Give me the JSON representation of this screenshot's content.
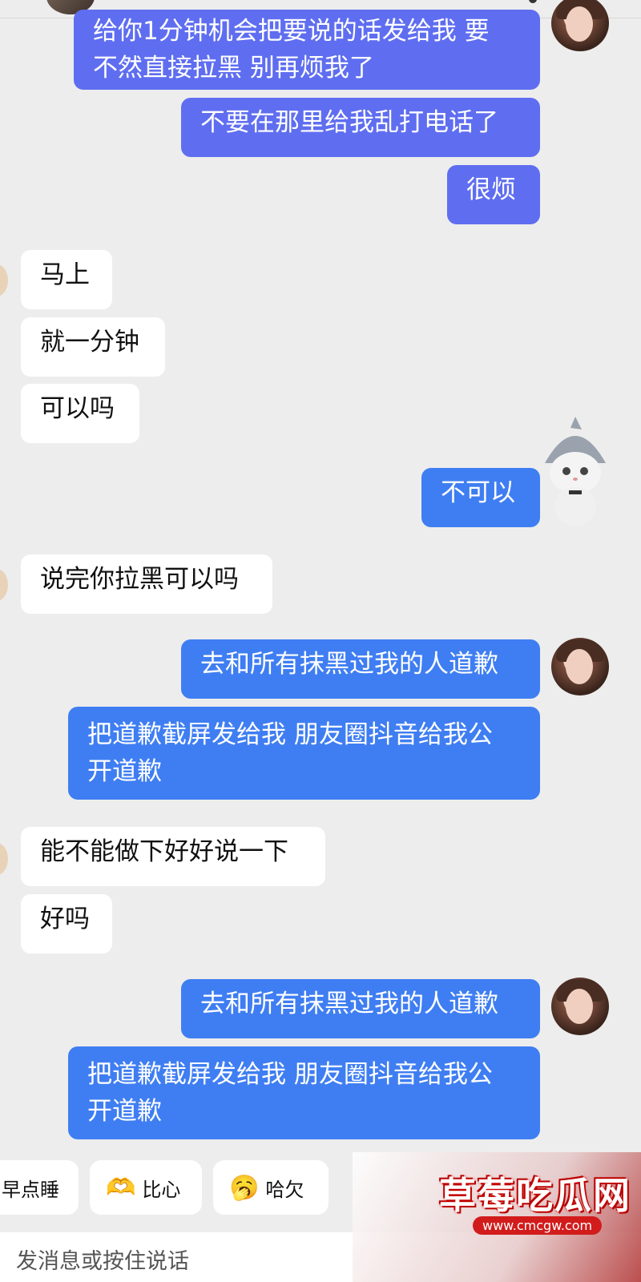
{
  "messages": [
    {
      "text": "给你1分钟机会把要说的话发给我 要\n不然直接拉黑 别再烦我了"
    },
    {
      "text": "不要在那里给我乱打电话了"
    },
    {
      "text": "很烦"
    },
    {
      "text": "马上"
    },
    {
      "text": "就一分钟"
    },
    {
      "text": "可以吗"
    },
    {
      "text": "不可以"
    },
    {
      "text": "说完你拉黑可以吗"
    },
    {
      "text": "去和所有抹黑过我的人道歉"
    },
    {
      "text": "把道歉截屏发给我 朋友圈抖音给我公\n开道歉"
    },
    {
      "text": "能不能做下好好说一下"
    },
    {
      "text": "好吗"
    },
    {
      "text": "去和所有抹黑过我的人道歉"
    },
    {
      "text": "把道歉截屏发给我 朋友圈抖音给我公\n开道歉"
    }
  ],
  "quick_replies": [
    {
      "label": "早点睡",
      "icon": ""
    },
    {
      "label": "比心",
      "icon": "heart-hands-emoji-icon",
      "glyph": "🫶"
    },
    {
      "label": "哈欠",
      "icon": "yawn-emoji-icon",
      "glyph": "🥱"
    }
  ],
  "input": {
    "placeholder": "发消息或按住说话"
  },
  "watermark": {
    "title": "草莓吃瓜网",
    "url": "www.cmcgw.com"
  },
  "colors": {
    "outgoing_bubble": "#3f7ef2",
    "outgoing_bubble_alt": "#5f6ef0",
    "incoming_bubble": "#ffffff",
    "background": "#ededed"
  }
}
